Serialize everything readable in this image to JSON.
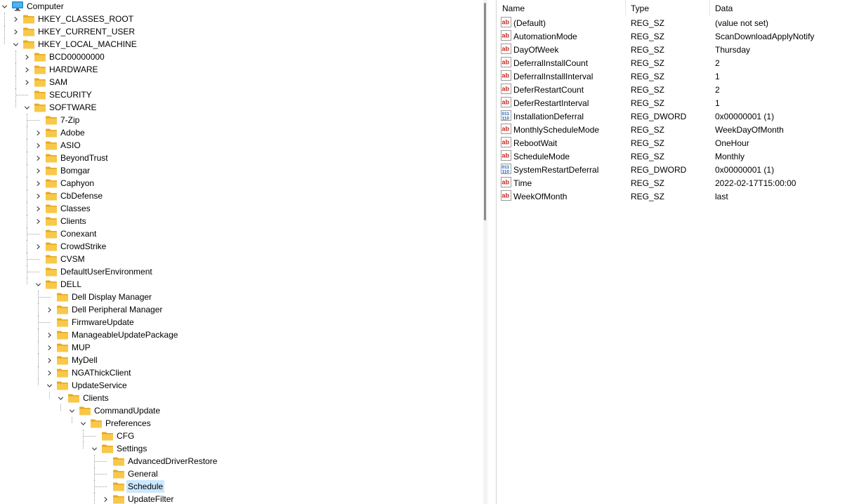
{
  "tree": [
    {
      "depth": 0,
      "label": "Computer",
      "kind": "computer",
      "state": "expanded"
    },
    {
      "depth": 1,
      "label": "HKEY_CLASSES_ROOT",
      "state": "collapsed"
    },
    {
      "depth": 1,
      "label": "HKEY_CURRENT_USER",
      "state": "collapsed"
    },
    {
      "depth": 1,
      "label": "HKEY_LOCAL_MACHINE",
      "state": "expanded"
    },
    {
      "depth": 2,
      "label": "BCD00000000",
      "state": "collapsed"
    },
    {
      "depth": 2,
      "label": "HARDWARE",
      "state": "collapsed"
    },
    {
      "depth": 2,
      "label": "SAM",
      "state": "collapsed"
    },
    {
      "depth": 2,
      "label": "SECURITY",
      "state": "leaf"
    },
    {
      "depth": 2,
      "label": "SOFTWARE",
      "state": "expanded"
    },
    {
      "depth": 3,
      "label": "7-Zip",
      "state": "leaf"
    },
    {
      "depth": 3,
      "label": "Adobe",
      "state": "collapsed"
    },
    {
      "depth": 3,
      "label": "ASIO",
      "state": "collapsed"
    },
    {
      "depth": 3,
      "label": "BeyondTrust",
      "state": "collapsed"
    },
    {
      "depth": 3,
      "label": "Bomgar",
      "state": "collapsed"
    },
    {
      "depth": 3,
      "label": "Caphyon",
      "state": "collapsed"
    },
    {
      "depth": 3,
      "label": "CbDefense",
      "state": "collapsed"
    },
    {
      "depth": 3,
      "label": "Classes",
      "state": "collapsed"
    },
    {
      "depth": 3,
      "label": "Clients",
      "state": "collapsed"
    },
    {
      "depth": 3,
      "label": "Conexant",
      "state": "leaf"
    },
    {
      "depth": 3,
      "label": "CrowdStrike",
      "state": "collapsed"
    },
    {
      "depth": 3,
      "label": "CVSM",
      "state": "leaf"
    },
    {
      "depth": 3,
      "label": "DefaultUserEnvironment",
      "state": "leaf"
    },
    {
      "depth": 3,
      "label": "DELL",
      "state": "expanded"
    },
    {
      "depth": 4,
      "label": "Dell Display Manager",
      "state": "leaf"
    },
    {
      "depth": 4,
      "label": "Dell Peripheral Manager",
      "state": "collapsed"
    },
    {
      "depth": 4,
      "label": "FirmwareUpdate",
      "state": "leaf"
    },
    {
      "depth": 4,
      "label": "ManageableUpdatePackage",
      "state": "collapsed"
    },
    {
      "depth": 4,
      "label": "MUP",
      "state": "collapsed"
    },
    {
      "depth": 4,
      "label": "MyDell",
      "state": "collapsed"
    },
    {
      "depth": 4,
      "label": "NGAThickClient",
      "state": "collapsed"
    },
    {
      "depth": 4,
      "label": "UpdateService",
      "state": "expanded"
    },
    {
      "depth": 5,
      "label": "Clients",
      "state": "expanded"
    },
    {
      "depth": 6,
      "label": "CommandUpdate",
      "state": "expanded"
    },
    {
      "depth": 7,
      "label": "Preferences",
      "state": "expanded"
    },
    {
      "depth": 8,
      "label": "CFG",
      "state": "leaf"
    },
    {
      "depth": 8,
      "label": "Settings",
      "state": "expanded"
    },
    {
      "depth": 9,
      "label": "AdvancedDriverRestore",
      "state": "leaf"
    },
    {
      "depth": 9,
      "label": "General",
      "state": "leaf"
    },
    {
      "depth": 9,
      "label": "Schedule",
      "state": "leaf",
      "selected": true
    },
    {
      "depth": 9,
      "label": "UpdateFilter",
      "state": "collapsed"
    }
  ],
  "columns": {
    "name": "Name",
    "type": "Type",
    "data": "Data"
  },
  "values": [
    {
      "icon": "string-value-icon",
      "name": "(Default)",
      "type": "REG_SZ",
      "data": "(value not set)"
    },
    {
      "icon": "string-value-icon",
      "name": "AutomationMode",
      "type": "REG_SZ",
      "data": "ScanDownloadApplyNotify"
    },
    {
      "icon": "string-value-icon",
      "name": "DayOfWeek",
      "type": "REG_SZ",
      "data": "Thursday"
    },
    {
      "icon": "string-value-icon",
      "name": "DeferralInstallCount",
      "type": "REG_SZ",
      "data": "2"
    },
    {
      "icon": "string-value-icon",
      "name": "DeferralInstallInterval",
      "type": "REG_SZ",
      "data": "1"
    },
    {
      "icon": "string-value-icon",
      "name": "DeferRestartCount",
      "type": "REG_SZ",
      "data": "2"
    },
    {
      "icon": "string-value-icon",
      "name": "DeferRestartInterval",
      "type": "REG_SZ",
      "data": "1"
    },
    {
      "icon": "binary-value-icon",
      "name": "InstallationDeferral",
      "type": "REG_DWORD",
      "data": "0x00000001 (1)"
    },
    {
      "icon": "string-value-icon",
      "name": "MonthlyScheduleMode",
      "type": "REG_SZ",
      "data": "WeekDayOfMonth"
    },
    {
      "icon": "string-value-icon",
      "name": "RebootWait",
      "type": "REG_SZ",
      "data": "OneHour"
    },
    {
      "icon": "string-value-icon",
      "name": "ScheduleMode",
      "type": "REG_SZ",
      "data": "Monthly"
    },
    {
      "icon": "binary-value-icon",
      "name": "SystemRestartDeferral",
      "type": "REG_DWORD",
      "data": "0x00000001 (1)"
    },
    {
      "icon": "string-value-icon",
      "name": "Time",
      "type": "REG_SZ",
      "data": "2022-02-17T15:00:00"
    },
    {
      "icon": "string-value-icon",
      "name": "WeekOfMonth",
      "type": "REG_SZ",
      "data": "last"
    }
  ],
  "colors": {
    "selection": "#cce8ff",
    "folder": "#f8c84a",
    "computer": "#1e8fd6"
  }
}
